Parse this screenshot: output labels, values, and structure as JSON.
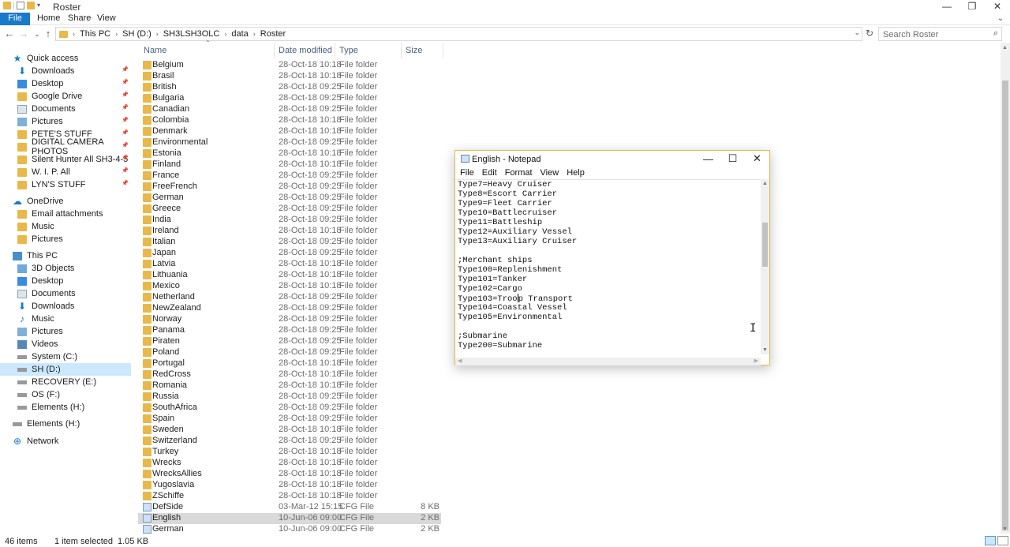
{
  "window": {
    "title": "Roster",
    "controls": {
      "minimize": "—",
      "maximize": "❐",
      "close": "✕"
    }
  },
  "ribbon": {
    "tabs": [
      "File",
      "Home",
      "Share",
      "View"
    ],
    "expand": "⌄"
  },
  "nav": {
    "back": "←",
    "forward": "→",
    "recent": "⌄",
    "up": "↑"
  },
  "address": {
    "crumbs": [
      "This PC",
      "SH (D:)",
      "SH3LSH3OLC",
      "data",
      "Roster"
    ],
    "separator": "›",
    "dropdown": "⌄",
    "refresh": "↻"
  },
  "search": {
    "placeholder": "Search Roster",
    "icon": "⌕"
  },
  "navpane": {
    "items": [
      {
        "label": "Quick access",
        "icon": "star",
        "pinned": false,
        "selected": false,
        "indent": 16
      },
      {
        "label": "Downloads",
        "icon": "down",
        "pinned": true,
        "selected": false,
        "indent": 22
      },
      {
        "label": "Desktop",
        "icon": "desk",
        "pinned": true,
        "selected": false,
        "indent": 22
      },
      {
        "label": "Google Drive",
        "icon": "fold",
        "pinned": true,
        "selected": false,
        "indent": 22
      },
      {
        "label": "Documents",
        "icon": "doc",
        "pinned": true,
        "selected": false,
        "indent": 22
      },
      {
        "label": "Pictures",
        "icon": "pic",
        "pinned": true,
        "selected": false,
        "indent": 22
      },
      {
        "label": "PETE'S STUFF",
        "icon": "fold",
        "pinned": true,
        "selected": false,
        "indent": 22
      },
      {
        "label": "DIGITAL CAMERA PHOTOS",
        "icon": "fold",
        "pinned": true,
        "selected": false,
        "indent": 22
      },
      {
        "label": "Silent Hunter All SH3-4-5",
        "icon": "fold",
        "pinned": true,
        "selected": false,
        "indent": 22
      },
      {
        "label": "W. I. P. All",
        "icon": "fold",
        "pinned": true,
        "selected": false,
        "indent": 22
      },
      {
        "label": "LYN'S STUFF",
        "icon": "fold",
        "pinned": true,
        "selected": false,
        "indent": 22
      },
      {
        "label": "OneDrive",
        "icon": "cloud",
        "pinned": false,
        "selected": false,
        "indent": 16
      },
      {
        "label": "Email attachments",
        "icon": "fold",
        "pinned": false,
        "selected": false,
        "indent": 22
      },
      {
        "label": "Music",
        "icon": "fold",
        "pinned": false,
        "selected": false,
        "indent": 22
      },
      {
        "label": "Pictures",
        "icon": "fold",
        "pinned": false,
        "selected": false,
        "indent": 22
      },
      {
        "label": "This PC",
        "icon": "pc",
        "pinned": false,
        "selected": false,
        "indent": 16
      },
      {
        "label": "3D Objects",
        "icon": "obj",
        "pinned": false,
        "selected": false,
        "indent": 22
      },
      {
        "label": "Desktop",
        "icon": "desk",
        "pinned": false,
        "selected": false,
        "indent": 22
      },
      {
        "label": "Documents",
        "icon": "doc",
        "pinned": false,
        "selected": false,
        "indent": 22
      },
      {
        "label": "Downloads",
        "icon": "down",
        "pinned": false,
        "selected": false,
        "indent": 22
      },
      {
        "label": "Music",
        "icon": "music",
        "pinned": false,
        "selected": false,
        "indent": 22
      },
      {
        "label": "Pictures",
        "icon": "pic",
        "pinned": false,
        "selected": false,
        "indent": 22
      },
      {
        "label": "Videos",
        "icon": "vid",
        "pinned": false,
        "selected": false,
        "indent": 22
      },
      {
        "label": "System (C:)",
        "icon": "drive",
        "pinned": false,
        "selected": false,
        "indent": 22
      },
      {
        "label": "SH (D:)",
        "icon": "drive",
        "pinned": false,
        "selected": true,
        "indent": 22
      },
      {
        "label": "RECOVERY (E:)",
        "icon": "drive",
        "pinned": false,
        "selected": false,
        "indent": 22
      },
      {
        "label": "OS (F:)",
        "icon": "drive",
        "pinned": false,
        "selected": false,
        "indent": 22
      },
      {
        "label": "Elements (H:)",
        "icon": "drive",
        "pinned": false,
        "selected": false,
        "indent": 22
      },
      {
        "label": "Elements (H:)",
        "icon": "drive",
        "pinned": false,
        "selected": false,
        "indent": 16
      },
      {
        "label": "Network",
        "icon": "net",
        "pinned": false,
        "selected": false,
        "indent": 16
      }
    ]
  },
  "columns": {
    "name": "Name",
    "date": "Date modified",
    "type": "Type",
    "size": "Size",
    "sort_indicator": "⌃"
  },
  "files": [
    {
      "name": "Belgium",
      "date": "28-Oct-18 10:18",
      "type": "File folder",
      "size": "",
      "kind": "folder"
    },
    {
      "name": "Brasil",
      "date": "28-Oct-18 10:18",
      "type": "File folder",
      "size": "",
      "kind": "folder"
    },
    {
      "name": "British",
      "date": "28-Oct-18 09:25",
      "type": "File folder",
      "size": "",
      "kind": "folder"
    },
    {
      "name": "Bulgaria",
      "date": "28-Oct-18 09:25",
      "type": "File folder",
      "size": "",
      "kind": "folder"
    },
    {
      "name": "Canadian",
      "date": "28-Oct-18 09:25",
      "type": "File folder",
      "size": "",
      "kind": "folder"
    },
    {
      "name": "Colombia",
      "date": "28-Oct-18 10:18",
      "type": "File folder",
      "size": "",
      "kind": "folder"
    },
    {
      "name": "Denmark",
      "date": "28-Oct-18 10:18",
      "type": "File folder",
      "size": "",
      "kind": "folder"
    },
    {
      "name": "Environmental",
      "date": "28-Oct-18 09:25",
      "type": "File folder",
      "size": "",
      "kind": "folder"
    },
    {
      "name": "Estonia",
      "date": "28-Oct-18 10:18",
      "type": "File folder",
      "size": "",
      "kind": "folder"
    },
    {
      "name": "Finland",
      "date": "28-Oct-18 10:18",
      "type": "File folder",
      "size": "",
      "kind": "folder"
    },
    {
      "name": "France",
      "date": "28-Oct-18 09:25",
      "type": "File folder",
      "size": "",
      "kind": "folder"
    },
    {
      "name": "FreeFrench",
      "date": "28-Oct-18 09:25",
      "type": "File folder",
      "size": "",
      "kind": "folder"
    },
    {
      "name": "German",
      "date": "28-Oct-18 09:25",
      "type": "File folder",
      "size": "",
      "kind": "folder"
    },
    {
      "name": "Greece",
      "date": "28-Oct-18 09:25",
      "type": "File folder",
      "size": "",
      "kind": "folder"
    },
    {
      "name": "India",
      "date": "28-Oct-18 09:25",
      "type": "File folder",
      "size": "",
      "kind": "folder"
    },
    {
      "name": "Ireland",
      "date": "28-Oct-18 10:18",
      "type": "File folder",
      "size": "",
      "kind": "folder"
    },
    {
      "name": "Italian",
      "date": "28-Oct-18 09:25",
      "type": "File folder",
      "size": "",
      "kind": "folder"
    },
    {
      "name": "Japan",
      "date": "28-Oct-18 09:25",
      "type": "File folder",
      "size": "",
      "kind": "folder"
    },
    {
      "name": "Latvia",
      "date": "28-Oct-18 10:18",
      "type": "File folder",
      "size": "",
      "kind": "folder"
    },
    {
      "name": "Lithuania",
      "date": "28-Oct-18 10:18",
      "type": "File folder",
      "size": "",
      "kind": "folder"
    },
    {
      "name": "Mexico",
      "date": "28-Oct-18 10:18",
      "type": "File folder",
      "size": "",
      "kind": "folder"
    },
    {
      "name": "Netherland",
      "date": "28-Oct-18 09:25",
      "type": "File folder",
      "size": "",
      "kind": "folder"
    },
    {
      "name": "NewZealand",
      "date": "28-Oct-18 09:25",
      "type": "File folder",
      "size": "",
      "kind": "folder"
    },
    {
      "name": "Norway",
      "date": "28-Oct-18 09:25",
      "type": "File folder",
      "size": "",
      "kind": "folder"
    },
    {
      "name": "Panama",
      "date": "28-Oct-18 09:25",
      "type": "File folder",
      "size": "",
      "kind": "folder"
    },
    {
      "name": "Piraten",
      "date": "28-Oct-18 09:25",
      "type": "File folder",
      "size": "",
      "kind": "folder"
    },
    {
      "name": "Poland",
      "date": "28-Oct-18 09:25",
      "type": "File folder",
      "size": "",
      "kind": "folder"
    },
    {
      "name": "Portugal",
      "date": "28-Oct-18 10:18",
      "type": "File folder",
      "size": "",
      "kind": "folder"
    },
    {
      "name": "RedCross",
      "date": "28-Oct-18 10:18",
      "type": "File folder",
      "size": "",
      "kind": "folder"
    },
    {
      "name": "Romania",
      "date": "28-Oct-18 10:18",
      "type": "File folder",
      "size": "",
      "kind": "folder"
    },
    {
      "name": "Russia",
      "date": "28-Oct-18 09:25",
      "type": "File folder",
      "size": "",
      "kind": "folder"
    },
    {
      "name": "SouthAfrica",
      "date": "28-Oct-18 09:25",
      "type": "File folder",
      "size": "",
      "kind": "folder"
    },
    {
      "name": "Spain",
      "date": "28-Oct-18 09:25",
      "type": "File folder",
      "size": "",
      "kind": "folder"
    },
    {
      "name": "Sweden",
      "date": "28-Oct-18 10:18",
      "type": "File folder",
      "size": "",
      "kind": "folder"
    },
    {
      "name": "Switzerland",
      "date": "28-Oct-18 09:25",
      "type": "File folder",
      "size": "",
      "kind": "folder"
    },
    {
      "name": "Turkey",
      "date": "28-Oct-18 10:18",
      "type": "File folder",
      "size": "",
      "kind": "folder"
    },
    {
      "name": "Wrecks",
      "date": "28-Oct-18 10:18",
      "type": "File folder",
      "size": "",
      "kind": "folder"
    },
    {
      "name": "WrecksAllies",
      "date": "28-Oct-18 10:18",
      "type": "File folder",
      "size": "",
      "kind": "folder"
    },
    {
      "name": "Yugoslavia",
      "date": "28-Oct-18 10:18",
      "type": "File folder",
      "size": "",
      "kind": "folder"
    },
    {
      "name": "ZSchiffe",
      "date": "28-Oct-18 10:18",
      "type": "File folder",
      "size": "",
      "kind": "folder"
    },
    {
      "name": "DefSide",
      "date": "03-Mar-12 15:15",
      "type": "CFG File",
      "size": "8 KB",
      "kind": "cfg"
    },
    {
      "name": "English",
      "date": "10-Jun-06 09:00",
      "type": "CFG File",
      "size": "2 KB",
      "kind": "cfg",
      "selected": true
    },
    {
      "name": "German",
      "date": "10-Jun-06 09:00",
      "type": "CFG File",
      "size": "2 KB",
      "kind": "cfg"
    }
  ],
  "status": {
    "items": "46 items",
    "selected": "1 item selected",
    "size": "1.05 KB"
  },
  "notepad": {
    "title": "English - Notepad",
    "controls": {
      "minimize": "—",
      "maximize": "☐",
      "close": "✕"
    },
    "menu": [
      "File",
      "Edit",
      "Format",
      "View",
      "Help"
    ],
    "lines": [
      "Type7=Heavy Cruiser",
      "Type8=Escort Carrier",
      "Type9=Fleet Carrier",
      "Type10=Battlecruiser",
      "Type11=Battleship",
      "Type12=Auxiliary Vessel",
      "Type13=Auxiliary Cruiser",
      "",
      ";Merchant ships",
      "Type100=Replenishment",
      "Type101=Tanker",
      "Type102=Cargo",
      "Type103=Troop Transport",
      "Type104=Coastal Vessel",
      "Type105=Environmental",
      "",
      ";Submarine",
      "Type200=Submarine"
    ],
    "caret": {
      "line": 12,
      "col": 12
    },
    "scroll_position": 0.3
  },
  "colors": {
    "accent": "#1979ca",
    "folder": "#e8b84a",
    "selection": "#cce8ff",
    "row_selected": "#d9d9d9"
  }
}
